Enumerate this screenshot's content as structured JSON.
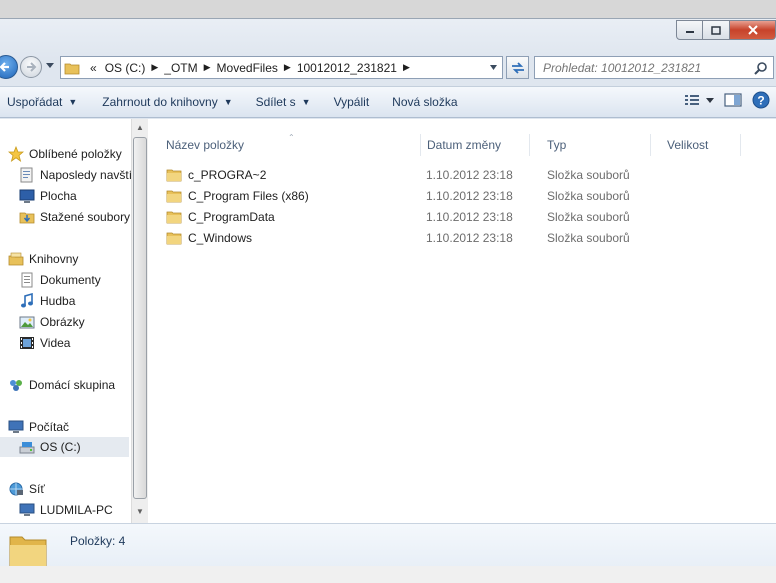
{
  "address": {
    "prefix": "«",
    "crumbs": [
      "OS (C:)",
      "_OTM",
      "MovedFiles",
      "10012012_231821"
    ]
  },
  "search": {
    "placeholder": "Prohledat: 10012012_231821"
  },
  "toolbar": {
    "organize": "Uspořádat",
    "include": "Zahrnout do knihovny",
    "share": "Sdílet s",
    "burn": "Vypálit",
    "new_folder": "Nová složka"
  },
  "sidebar": {
    "favorites": "Oblíbené položky",
    "recent": "Naposledy navštívené",
    "desktop": "Plocha",
    "downloads": "Stažené soubory",
    "libraries": "Knihovny",
    "documents": "Dokumenty",
    "music": "Hudba",
    "pictures": "Obrázky",
    "videos": "Videa",
    "homegroup": "Domácí skupina",
    "computer": "Počítač",
    "drive_c": "OS (C:)",
    "network": "Síť",
    "pc": "LUDMILA-PC"
  },
  "columns": {
    "name": "Název položky",
    "date": "Datum změny",
    "type": "Typ",
    "size": "Velikost"
  },
  "files": [
    {
      "name": "c_PROGRA~2",
      "date": "1.10.2012 23:18",
      "type": "Složka souborů"
    },
    {
      "name": "C_Program Files (x86)",
      "date": "1.10.2012 23:18",
      "type": "Složka souborů"
    },
    {
      "name": "C_ProgramData",
      "date": "1.10.2012 23:18",
      "type": "Složka souborů"
    },
    {
      "name": "C_Windows",
      "date": "1.10.2012 23:18",
      "type": "Složka souborů"
    }
  ],
  "details": {
    "count": "Položky: 4"
  },
  "colors": {
    "folder": "#e8c15a",
    "selection": "#e5eaf0",
    "link": "#1e395b"
  }
}
